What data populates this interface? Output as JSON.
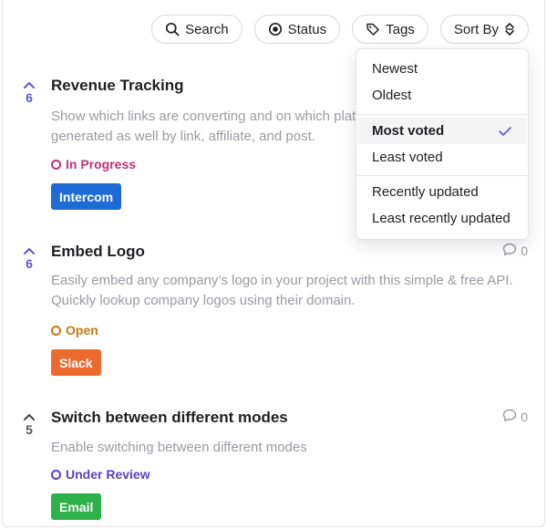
{
  "toolbar": {
    "search_label": "Search",
    "status_label": "Status",
    "tags_label": "Tags",
    "sort_label": "Sort By"
  },
  "posts": [
    {
      "votes": "6",
      "title": "Revenue Tracking",
      "description": "Show which links are converting and on which platform, and track the revenue generated as well by link, affiliate, and post.",
      "status": "In Progress",
      "tag": "Intercom"
    },
    {
      "votes": "6",
      "title": "Embed Logo",
      "comments": "0",
      "description": "Easily embed any company’s logo in your project with this simple & free API. Quickly lookup company logos using their domain.",
      "status": "Open",
      "tag": "Slack"
    },
    {
      "votes": "5",
      "title": "Switch between different modes",
      "comments": "0",
      "description": "Enable switching between different modes",
      "status": "Under Review",
      "tag": "Email"
    }
  ],
  "sort_menu": {
    "items": [
      "Newest",
      "Oldest",
      "Most voted",
      "Least voted",
      "Recently updated",
      "Least recently updated"
    ],
    "selected": "Most voted"
  },
  "colors": {
    "accent": "#5b57d9",
    "in_progress": "#c2307a",
    "open": "#c47a12",
    "under_review": "#5b3fc4",
    "intercom": "#1f6bd6",
    "slack": "#ec6a2e",
    "email": "#2eb04a"
  }
}
